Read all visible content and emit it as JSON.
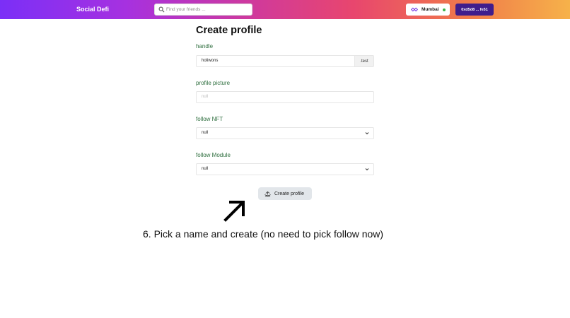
{
  "header": {
    "brand": "Social Defi",
    "search": {
      "placeholder": "Find your friends ...",
      "value": ""
    },
    "network": {
      "label": "Mumbai",
      "icon": "polygon-icon",
      "status_color": "#3ab54a"
    },
    "wallet": {
      "label": "0xd5d8 ... fe51"
    }
  },
  "form": {
    "title": "Create profile",
    "handle": {
      "label": "handle",
      "value": "holiwons",
      "suffix": ".test"
    },
    "profile_picture": {
      "label": "profile picture",
      "placeholder": "null"
    },
    "follow_nft": {
      "label": "follow NFT",
      "value": "null"
    },
    "follow_module": {
      "label": "follow Module",
      "value": "null"
    },
    "submit": {
      "label": "Create profile",
      "icon": "mint-icon"
    }
  },
  "annotation": {
    "arrow": "arrow-up-right-icon",
    "caption": "6. Pick a name and create (no need to pick follow now)"
  },
  "colors": {
    "label_green": "#2e6e3e",
    "wallet_bg": "#3f1d8c",
    "button_bg": "#e2e6ea"
  }
}
